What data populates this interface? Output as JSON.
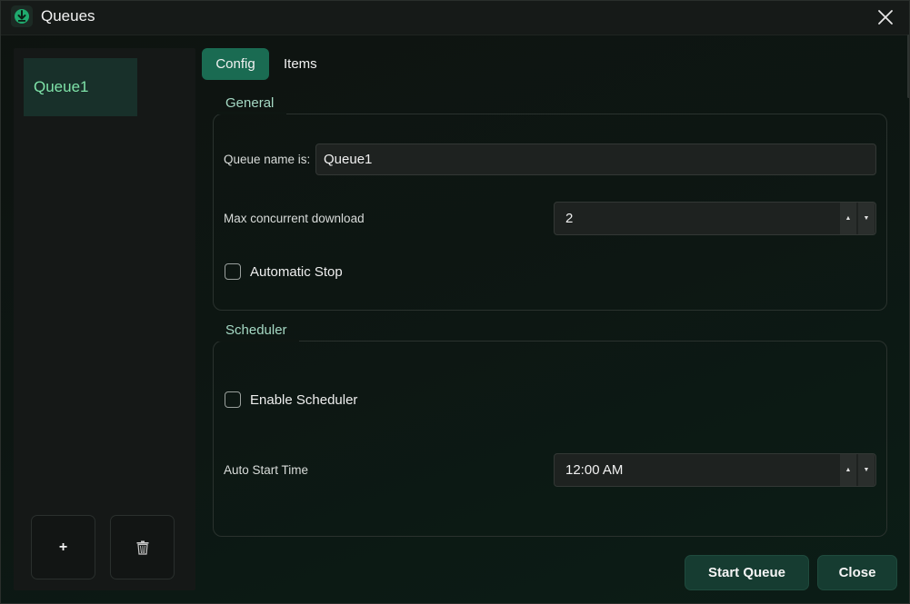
{
  "window": {
    "title": "Queues",
    "icon": "download-app-icon",
    "close_icon": "close-icon"
  },
  "sidebar": {
    "queues": [
      {
        "label": "Queue1",
        "selected": true
      }
    ],
    "add_label": "+",
    "delete_icon": "trash-icon"
  },
  "tabs": [
    {
      "label": "Config",
      "active": true
    },
    {
      "label": "Items",
      "active": false
    }
  ],
  "general": {
    "group_title": "General",
    "queue_name_label": "Queue name is:",
    "queue_name_value": "Queue1",
    "max_concurrent_label": "Max concurrent download",
    "max_concurrent_value": "2",
    "automatic_stop_label": "Automatic Stop",
    "automatic_stop_checked": false
  },
  "scheduler": {
    "group_title": "Scheduler",
    "enable_label": "Enable Scheduler",
    "enable_checked": false,
    "auto_start_label": "Auto Start Time",
    "auto_start_value": "12:00 AM"
  },
  "actions": {
    "start_label": "Start Queue",
    "close_label": "Close"
  },
  "colors": {
    "accent": "#1a6b52",
    "accent_text": "#7fe3a9",
    "button_bg": "#163c31",
    "background": "#0d1713"
  }
}
